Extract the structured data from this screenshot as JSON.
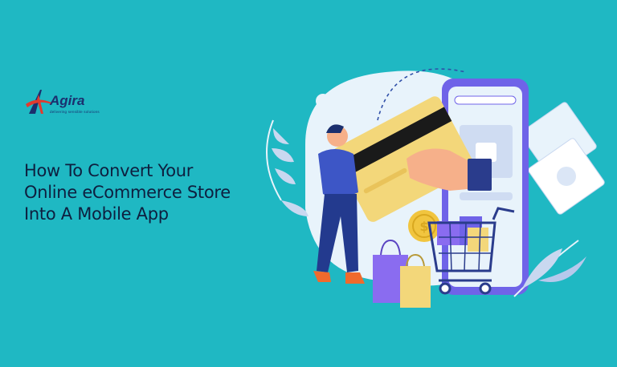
{
  "logo": {
    "brand": "Agira",
    "tagline": "delivering sensible solutions"
  },
  "headline": {
    "lines": [
      "How To Convert Your",
      "Online eCommerce Store",
      "Into A Mobile App"
    ]
  },
  "colors": {
    "background": "#1fb8c3",
    "headline_text": "#0e1f3f",
    "brand_navy": "#1b2f6e",
    "brand_red": "#e23a2e",
    "phone_purple": "#6f63e8",
    "card_yellow": "#f3d77a",
    "bag_purple": "#8a6cf0",
    "shoe_orange": "#f06a2c"
  },
  "illustration": {
    "icons": [
      "person-icon",
      "credit-card-icon",
      "smartphone-icon",
      "hand-icon",
      "coin-icon",
      "shopping-cart-icon",
      "shopping-bag-icon",
      "cash-icon",
      "leaf-icon"
    ],
    "coin_symbol": "$"
  }
}
